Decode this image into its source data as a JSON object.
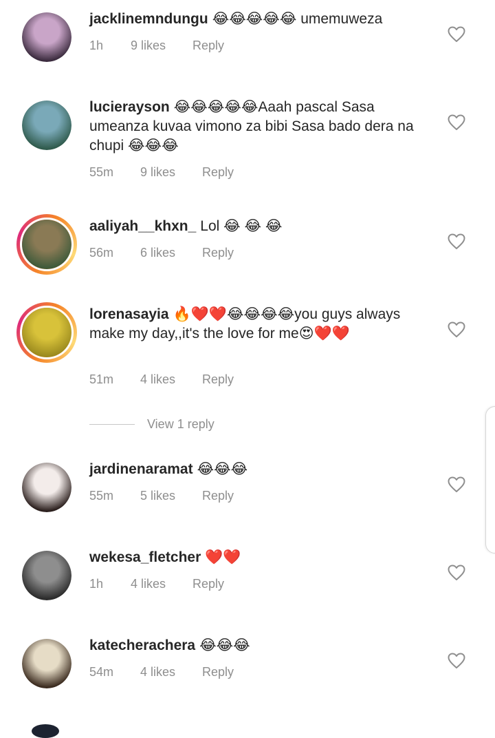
{
  "comments": [
    {
      "username": "jacklinemndungu",
      "text": "😂😂😂😂😂 umemuweza",
      "time": "1h",
      "likes": "9 likes",
      "reply": "Reply",
      "story_ring": false,
      "avatar_colors": [
        "#c9a5c8",
        "#3b2b3e"
      ]
    },
    {
      "username": "lucierayson",
      "text": "😂😂😂😂😂Aaah pascal Sasa umeanza kuvaa vimono za bibi Sasa bado dera na chupi 😂😂😂",
      "time": "55m",
      "likes": "9 likes",
      "reply": "Reply",
      "story_ring": false,
      "avatar_colors": [
        "#7aa9b8",
        "#2f5a4c"
      ]
    },
    {
      "username": "aaliyah__khxn_",
      "text": "Lol 😂 😂 😂",
      "time": "56m",
      "likes": "6 likes",
      "reply": "Reply",
      "story_ring": true,
      "avatar_colors": [
        "#8a7a55",
        "#3e5a3a"
      ]
    },
    {
      "username": "lorenasayia",
      "text": "🔥❤️❤️😂😂😂😂you guys always make my day,,it's the love for me😍❤️❤️",
      "time": "51m",
      "likes": "4 likes",
      "reply": "Reply",
      "story_ring": true,
      "avatar_colors": [
        "#d8c23a",
        "#9b8a1e"
      ]
    },
    {
      "username": "jardinenaramat",
      "text": "😂😂😂",
      "time": "55m",
      "likes": "5 likes",
      "reply": "Reply",
      "story_ring": false,
      "avatar_colors": [
        "#f3ecea",
        "#2a1e1c"
      ]
    },
    {
      "username": "wekesa_fletcher",
      "text": "❤️❤️",
      "time": "1h",
      "likes": "4 likes",
      "reply": "Reply",
      "story_ring": false,
      "avatar_colors": [
        "#8e8e8e",
        "#2b2b2b"
      ]
    },
    {
      "username": "katecherachera",
      "text": "😂😂😂",
      "time": "54m",
      "likes": "4 likes",
      "reply": "Reply",
      "story_ring": false,
      "avatar_colors": [
        "#e6dcc6",
        "#3a2a1e"
      ]
    }
  ],
  "view_replies": "View 1 reply",
  "icons": {
    "like": "heart-outline-icon"
  },
  "colors": {
    "text": "#262626",
    "meta": "#8e8e8e",
    "heart_stroke": "#8e8e8e"
  }
}
